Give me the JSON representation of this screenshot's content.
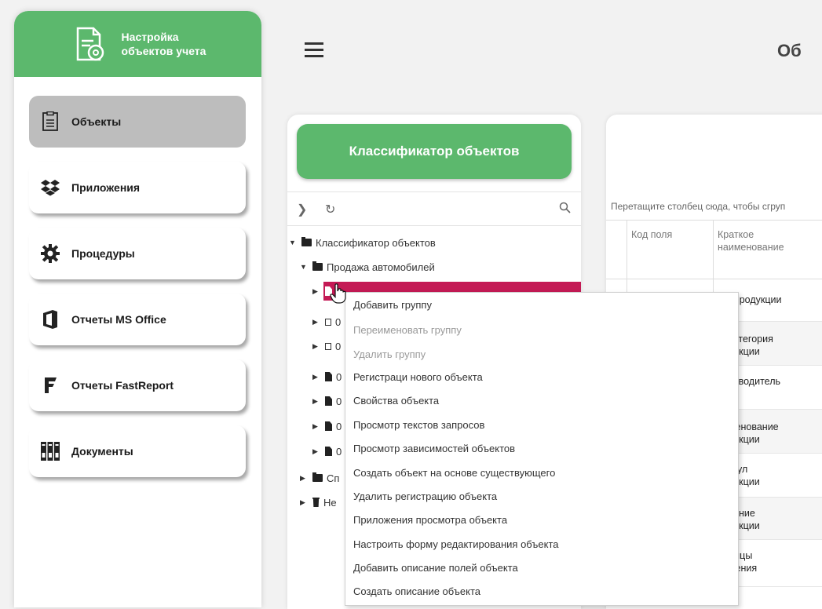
{
  "app": {
    "title": "Настройка\nобъектов учета"
  },
  "nav": [
    {
      "label": "Объекты",
      "icon": "document-list-icon",
      "active": true
    },
    {
      "label": "Приложения",
      "icon": "dropbox-icon",
      "active": false
    },
    {
      "label": "Процедуры",
      "icon": "gear-icon",
      "active": false
    },
    {
      "label": "Отчеты MS Office",
      "icon": "office-icon",
      "active": false
    },
    {
      "label": "Отчеты FastReport",
      "icon": "fastreport-icon",
      "active": false
    },
    {
      "label": "Документы",
      "icon": "binders-icon",
      "active": false
    }
  ],
  "header": {
    "page_title": "Об"
  },
  "classifier": {
    "button_label": "Классификатор объектов",
    "tree": [
      {
        "label": "Классификатор объектов",
        "icon": "folder-icon",
        "expanded": true
      },
      {
        "label": "Продажа автомобилей",
        "icon": "folder-icon",
        "expanded": true
      },
      {
        "label": "",
        "icon": "file-icon",
        "selected": true
      },
      {
        "label": "0",
        "icon": "box-icon"
      },
      {
        "label": "0",
        "icon": "box-icon"
      },
      {
        "label": "0",
        "icon": "file-icon"
      },
      {
        "label": "0",
        "icon": "file-icon"
      },
      {
        "label": "0",
        "icon": "file-icon"
      },
      {
        "label": "0",
        "icon": "file-icon"
      },
      {
        "label": "Сп",
        "icon": "folder-icon"
      },
      {
        "label": "Не",
        "icon": "trash-icon"
      }
    ]
  },
  "grid": {
    "group_hint": "Перетащите столбец сюда, чтобы сгруп",
    "columns": [
      "Код поля",
      "Краткое\nнаименование"
    ],
    "rows": [
      {
        "code": "",
        "name": "ИД продукции"
      },
      {
        "code": "",
        "name": "одкатегория\nродукции"
      },
      {
        "code": "",
        "name": "роизводитель"
      },
      {
        "code": "",
        "name": "аименование\nродукции"
      },
      {
        "code": "",
        "name": "ртикул\nродукции"
      },
      {
        "code": "",
        "name": "писание\nродукции"
      },
      {
        "code": "",
        "name": "диницы\nмерения"
      }
    ]
  },
  "context_menu": {
    "items": [
      {
        "label": "Добавить группу",
        "disabled": false
      },
      {
        "label": "Переименовать группу",
        "disabled": true
      },
      {
        "label": "Удалить группу",
        "disabled": true
      },
      {
        "label": "Регистраци нового объекта",
        "disabled": false
      },
      {
        "label": "Свойства объекта",
        "disabled": false
      },
      {
        "label": "Просмотр текстов запросов",
        "disabled": false
      },
      {
        "label": "Просмотр зависимостей объектов",
        "disabled": false
      },
      {
        "label": "Создать объект на основе существующего",
        "disabled": false
      },
      {
        "label": "Удалить регистрацию объекта",
        "disabled": false
      },
      {
        "label": "Приложения просмотра объекта",
        "disabled": false
      },
      {
        "label": "Настроить форму редактирования объекта",
        "disabled": false
      },
      {
        "label": "Добавить описание полей объекта",
        "disabled": false
      },
      {
        "label": "Создать описание объекта",
        "disabled": false
      }
    ]
  },
  "colors": {
    "accent": "#5cb86d",
    "selection": "#c41a55",
    "active_nav": "#bdbdbd"
  }
}
